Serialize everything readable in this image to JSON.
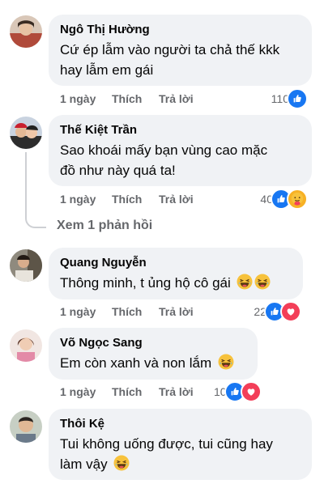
{
  "comments": [
    {
      "name": "Ngô Thị Hường",
      "text_line1": "Cứ ép lẫm vào người ta chả thế kkk",
      "text_line2": "hay lẫm em gái",
      "time": "1 ngày",
      "like_label": "Thích",
      "reply_label": "Trả lời",
      "reaction_count": "110",
      "reactions": [
        "like-icon"
      ]
    },
    {
      "name": "Thế Kiệt Trần",
      "text_line1": "Sao khoái mấy bạn vùng cao mặc",
      "text_line2": "đồ như này quá ta!",
      "time": "1 ngày",
      "like_label": "Thích",
      "reply_label": "Trả lời",
      "reaction_count": "40",
      "reactions": [
        "like-icon",
        "care-icon"
      ],
      "view_replies": "Xem 1 phản hồi"
    },
    {
      "name": "Quang Nguyễn",
      "text_line1": "Thông minh, t ủng hộ cô gái",
      "time": "1 ngày",
      "like_label": "Thích",
      "reply_label": "Trả lời",
      "reaction_count": "22",
      "reactions": [
        "like-icon",
        "heart-icon"
      ],
      "emojis": [
        "laughing-emoji",
        "laughing-emoji"
      ]
    },
    {
      "name": "Võ Ngọc Sang",
      "text_line1": "Em còn xanh và non lắm",
      "time": "1 ngày",
      "like_label": "Thích",
      "reply_label": "Trả lời",
      "reaction_count": "10",
      "reactions": [
        "like-icon",
        "heart-icon"
      ],
      "emojis": [
        "laughing-emoji"
      ]
    },
    {
      "name": "Thôi Kệ",
      "text_line1": "Tui không uống được, tui cũng hay",
      "text_line2": "làm vậy",
      "emojis": [
        "grinning-squint-emoji"
      ]
    }
  ],
  "colors": {
    "bubble": "#f0f2f5",
    "meta_text": "#65676b",
    "like_blue": "#1877f2",
    "heart_red": "#f33e58",
    "care_yellow": "#f7b125"
  }
}
